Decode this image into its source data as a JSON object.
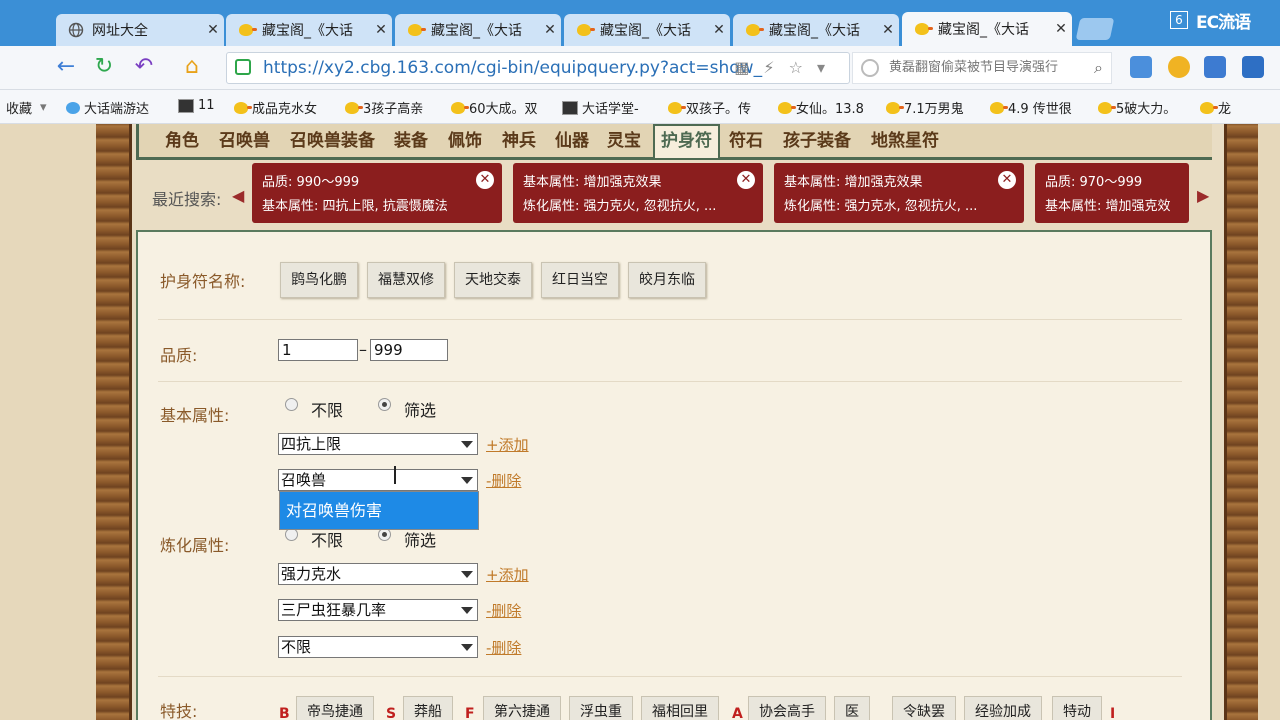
{
  "browser": {
    "tabs": [
      {
        "title": "网址大全",
        "icon": "globe-icon"
      },
      {
        "title": "藏宝阁_《大话",
        "icon": "duck-icon"
      },
      {
        "title": "藏宝阁_《大话",
        "icon": "duck-icon"
      },
      {
        "title": "藏宝阁_《大话",
        "icon": "duck-icon"
      },
      {
        "title": "藏宝阁_《大话",
        "icon": "duck-icon"
      },
      {
        "title": "藏宝阁_《大话",
        "icon": "duck-icon"
      }
    ],
    "window_count": "6",
    "brand": "EC流语",
    "url": "https://xy2.cbg.163.com/cgi-bin/equipquery.py?act=show_",
    "search_text": "黄磊翻窗偷菜被节目导演强行",
    "bookmarks": [
      {
        "label": "收藏"
      },
      {
        "label": "大话端游达"
      },
      {
        "label": "11"
      },
      {
        "label": "成品克水女"
      },
      {
        "label": "3孩子高亲"
      },
      {
        "label": "60大成。双"
      },
      {
        "label": "大话学堂-"
      },
      {
        "label": "双孩子。传"
      },
      {
        "label": "女仙。13.8"
      },
      {
        "label": "7.1万男鬼"
      },
      {
        "label": "4.9 传世很"
      },
      {
        "label": "5破大力。"
      },
      {
        "label": "龙"
      }
    ]
  },
  "categories": [
    "角色",
    "召唤兽",
    "召唤兽装备",
    "装备",
    "佩饰",
    "神兵",
    "仙器",
    "灵宝",
    "护身符",
    "符石",
    "孩子装备",
    "地煞星符"
  ],
  "active_category": "护身符",
  "recent": {
    "label": "最近搜索:",
    "cards": [
      {
        "line1": "品质: 990～999",
        "line2": "基本属性: 四抗上限, 抗震慑魔法"
      },
      {
        "line1": "基本属性: 增加强克效果",
        "line2": "炼化属性: 强力克火, 忽视抗火, ..."
      },
      {
        "line1": "基本属性: 增加强克效果",
        "line2": "炼化属性: 强力克水, 忽视抗火, ..."
      },
      {
        "line1": "品质: 970～999",
        "line2": "基本属性: 增加强克效"
      }
    ]
  },
  "form": {
    "name_label": "护身符名称:",
    "names": [
      "鹍鸟化鹏",
      "福慧双修",
      "天地交泰",
      "红日当空",
      "皎月东临"
    ],
    "quality_label": "品质:",
    "quality_min": "1",
    "quality_dash": "–",
    "quality_max": "999",
    "basic_label": "基本属性:",
    "radio_unlimited": "不限",
    "radio_filter": "筛选",
    "basic_select1": "四抗上限",
    "basic_select2": "召唤兽",
    "add_link": "+添加",
    "del_link": "-删除",
    "dropdown_option": "对召唤兽伤害",
    "refine_label": "炼化属性:",
    "refine_select1": "强力克水",
    "refine_select2": "三尸虫狂暴几率",
    "refine_select3": "不限",
    "trait_label": "特技:",
    "traits": [
      "帝鸟捷通",
      "莽船",
      "第六捷通",
      "浮虫重",
      "福相回里",
      "协会高手",
      "医",
      "令缺罢",
      "经验加成",
      "特动"
    ],
    "trait_letters": [
      "B",
      "S",
      "F",
      "A",
      "I"
    ]
  }
}
